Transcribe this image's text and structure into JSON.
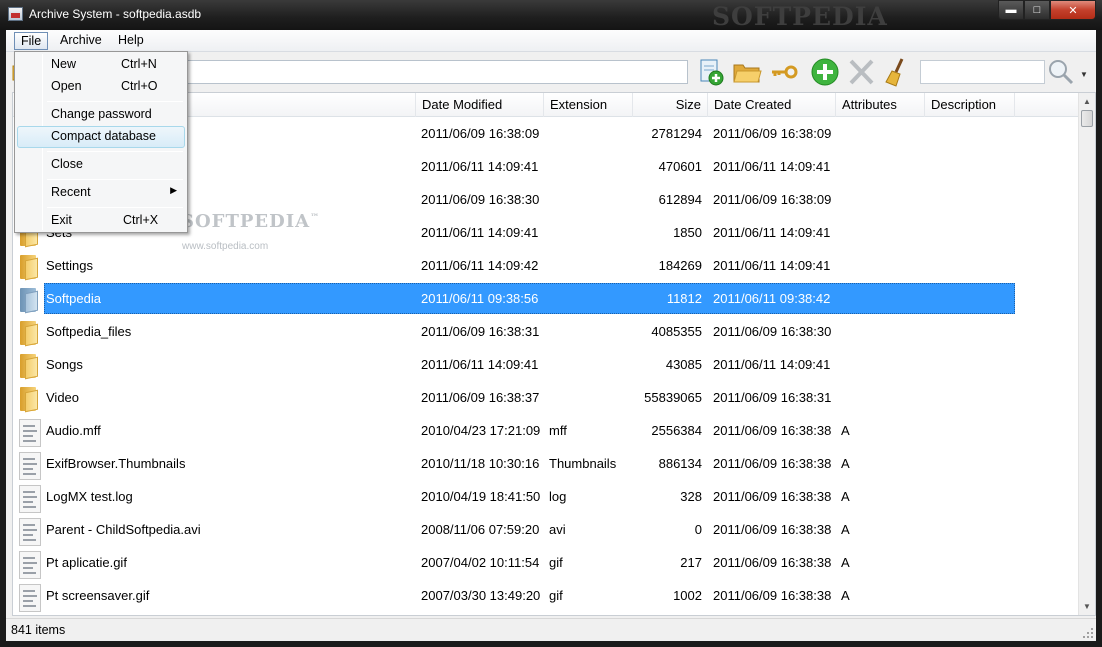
{
  "window": {
    "title": "Archive System - softpedia.asdb",
    "watermark": "SOFTPEDIA"
  },
  "menubar": {
    "file": "File",
    "archive": "Archive",
    "help": "Help"
  },
  "file_menu": {
    "new": "New",
    "new_shortcut": "Ctrl+N",
    "open": "Open",
    "open_shortcut": "Ctrl+O",
    "change_password": "Change password",
    "compact_database": "Compact database",
    "close": "Close",
    "recent": "Recent",
    "exit": "Exit",
    "exit_shortcut": "Ctrl+X"
  },
  "list_watermark": {
    "big": "SOFTPEDIA",
    "tm": "™",
    "small": "www.softpedia.com"
  },
  "columns": {
    "name": "",
    "date_modified": "Date Modified",
    "extension": "Extension",
    "size": "Size",
    "date_created": "Date Created",
    "attributes": "Attributes",
    "description": "Description"
  },
  "rows": [
    {
      "type": "folder",
      "name": "",
      "modified": "2011/06/09 16:38:09",
      "ext": "",
      "size": "2781294",
      "created": "2011/06/09 16:38:09",
      "attr": ""
    },
    {
      "type": "folder",
      "name": "",
      "modified": "2011/06/11 14:09:41",
      "ext": "",
      "size": "470601",
      "created": "2011/06/11 14:09:41",
      "attr": ""
    },
    {
      "type": "folder",
      "name": "",
      "modified": "2011/06/09 16:38:30",
      "ext": "",
      "size": "612894",
      "created": "2011/06/09 16:38:09",
      "attr": ""
    },
    {
      "type": "folder",
      "name": "Sets",
      "modified": "2011/06/11 14:09:41",
      "ext": "",
      "size": "1850",
      "created": "2011/06/11 14:09:41",
      "attr": ""
    },
    {
      "type": "folder",
      "name": "Settings",
      "modified": "2011/06/11 14:09:42",
      "ext": "",
      "size": "184269",
      "created": "2011/06/11 14:09:41",
      "attr": ""
    },
    {
      "type": "folder-selected",
      "name": "Softpedia",
      "modified": "2011/06/11 09:38:56",
      "ext": "",
      "size": "11812",
      "created": "2011/06/11 09:38:42",
      "attr": ""
    },
    {
      "type": "folder",
      "name": "Softpedia_files",
      "modified": "2011/06/09 16:38:31",
      "ext": "",
      "size": "4085355",
      "created": "2011/06/09 16:38:30",
      "attr": ""
    },
    {
      "type": "folder",
      "name": "Songs",
      "modified": "2011/06/11 14:09:41",
      "ext": "",
      "size": "43085",
      "created": "2011/06/11 14:09:41",
      "attr": ""
    },
    {
      "type": "folder",
      "name": "Video",
      "modified": "2011/06/09 16:38:37",
      "ext": "",
      "size": "55839065",
      "created": "2011/06/09 16:38:31",
      "attr": ""
    },
    {
      "type": "file",
      "name": "Audio.mff",
      "modified": "2010/04/23 17:21:09",
      "ext": "mff",
      "size": "2556384",
      "created": "2011/06/09 16:38:38",
      "attr": "A"
    },
    {
      "type": "file",
      "name": "ExifBrowser.Thumbnails",
      "modified": "2010/11/18 10:30:16",
      "ext": "Thumbnails",
      "size": "886134",
      "created": "2011/06/09 16:38:38",
      "attr": "A"
    },
    {
      "type": "file",
      "name": "LogMX test.log",
      "modified": "2010/04/19 18:41:50",
      "ext": "log",
      "size": "328",
      "created": "2011/06/09 16:38:38",
      "attr": "A"
    },
    {
      "type": "file",
      "name": "Parent - ChildSoftpedia.avi",
      "modified": "2008/11/06 07:59:20",
      "ext": "avi",
      "size": "0",
      "created": "2011/06/09 16:38:38",
      "attr": "A"
    },
    {
      "type": "file",
      "name": "Pt aplicatie.gif",
      "modified": "2007/04/02 10:11:54",
      "ext": "gif",
      "size": "217",
      "created": "2011/06/09 16:38:38",
      "attr": "A"
    },
    {
      "type": "file",
      "name": "Pt screensaver.gif",
      "modified": "2007/03/30 13:49:20",
      "ext": "gif",
      "size": "1002",
      "created": "2011/06/09 16:38:38",
      "attr": "A"
    }
  ],
  "status": {
    "count": "841 items"
  },
  "colors": {
    "selection": "#3399ff",
    "folder": "#f4cd6c",
    "close_button": "#c4402c"
  },
  "toolbar_icons": [
    "add-document-icon",
    "open-folder-icon",
    "key-icon",
    "add-icon",
    "delete-icon",
    "broom-icon",
    "search-icon"
  ]
}
